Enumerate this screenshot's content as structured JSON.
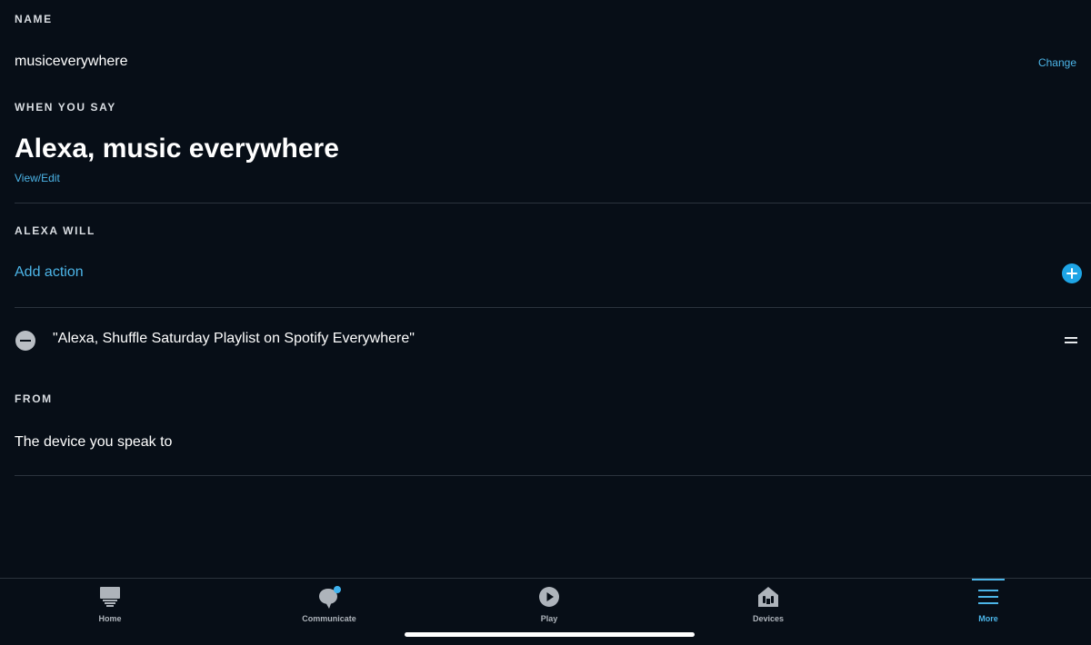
{
  "name_section": {
    "label": "NAME",
    "value": "musiceverywhere",
    "change_label": "Change"
  },
  "when_section": {
    "label": "WHEN YOU SAY",
    "utterance": "Alexa, music everywhere",
    "view_edit_label": "View/Edit"
  },
  "alexa_will_section": {
    "label": "ALEXA WILL",
    "add_action_label": "Add action",
    "actions": [
      {
        "text": "\"Alexa, Shuffle Saturday Playlist on Spotify Everywhere\""
      }
    ]
  },
  "from_section": {
    "label": "FROM",
    "value": "The device you speak to"
  },
  "colors": {
    "background": "#070e17",
    "accent": "#4cb5e8",
    "add_button": "#1ea5e6",
    "notification_dot": "#3fb3ef"
  },
  "nav": {
    "tabs": [
      {
        "label": "Home",
        "icon": "home-icon",
        "active": false
      },
      {
        "label": "Communicate",
        "icon": "chat-bubble-icon",
        "active": false,
        "has_notification": true
      },
      {
        "label": "Play",
        "icon": "play-icon",
        "active": false
      },
      {
        "label": "Devices",
        "icon": "devices-icon",
        "active": false
      },
      {
        "label": "More",
        "icon": "menu-icon",
        "active": true
      }
    ]
  }
}
